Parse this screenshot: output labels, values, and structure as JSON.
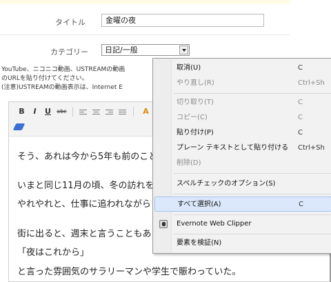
{
  "form": {
    "title_label": "タイトル",
    "title_value": "金曜の夜",
    "category_label": "カテゴリー",
    "category_value": "日記/一般",
    "video_note_line1": "YouTube、ニコニコ動画、USTREAMの動画",
    "video_note_line2": "のURLを貼り付けてください。",
    "video_note_line3": "(注意)USTREAMの動画表示は、Internet E"
  },
  "editor": {
    "toolbar": {
      "bold": "B",
      "italic": "I",
      "underline": "U",
      "strike": "abc",
      "color_glyph": "A"
    },
    "lines": [
      "そう、あれは今から5年も前のこと",
      "いまと同じ11月の頃、冬の訪れを",
      "やれやれと、仕事に追われながら",
      "街に出ると、週末と言うこともあり",
      "「夜はこれから」",
      "と言った雰囲気のサラリーマンや学生で賑わっていた。"
    ]
  },
  "context_menu": {
    "items": [
      {
        "label": "取消(U)",
        "shortcut": "C",
        "disabled": false
      },
      {
        "label": "やり直し(R)",
        "shortcut": "Ctrl+Sh",
        "disabled": true
      },
      {
        "label": "切り取り(T)",
        "shortcut": "C",
        "disabled": true
      },
      {
        "label": "コピー(C)",
        "shortcut": "C",
        "disabled": true
      },
      {
        "label": "貼り付け(P)",
        "shortcut": "C",
        "disabled": false
      },
      {
        "label": "プレーン テキストとして貼り付ける",
        "shortcut": "Ctrl+Sh",
        "disabled": false
      },
      {
        "label": "削除(D)",
        "shortcut": "",
        "disabled": true
      },
      {
        "label": "スペルチェックのオプション(S)",
        "shortcut": "",
        "disabled": false
      },
      {
        "label": "すべて選択(A)",
        "shortcut": "C",
        "disabled": false
      },
      {
        "label": "Evernote Web Clipper",
        "shortcut": "",
        "disabled": false
      },
      {
        "label": "要素を検証(N)",
        "shortcut": "",
        "disabled": false
      }
    ],
    "hover_color": "#dbe8fb",
    "icons": {
      "evernote": "evernote-elephant-icon"
    }
  }
}
